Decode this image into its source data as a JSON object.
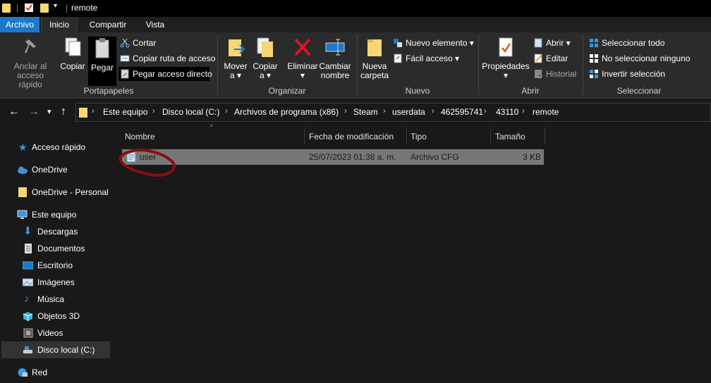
{
  "window": {
    "title": "remote"
  },
  "ribbon_tabs": [
    "Archivo",
    "Inicio",
    "Compartir",
    "Vista"
  ],
  "ribbon": {
    "portapapeles": {
      "label": "Portapapeles",
      "anclar": "Anclar al acceso rápido",
      "copiar": "Copiar",
      "pegar": "Pegar",
      "cortar": "Cortar",
      "copiar_ruta": "Copiar ruta de acceso",
      "pegar_acceso": "Pegar acceso directo"
    },
    "organizar": {
      "label": "Organizar",
      "mover": "Mover a",
      "copiar_a": "Copiar a",
      "eliminar": "Eliminar",
      "cambiar_nombre": "Cambiar nombre"
    },
    "nuevo": {
      "label": "Nuevo",
      "nueva_carpeta": "Nueva carpeta",
      "nuevo_elemento": "Nuevo elemento",
      "facil_acceso": "Fácil acceso"
    },
    "abrir": {
      "label": "Abrir",
      "propiedades": "Propiedades",
      "abrir": "Abrir",
      "editar": "Editar",
      "historial": "Historial"
    },
    "seleccionar": {
      "label": "Seleccionar",
      "todo": "Seleccionar todo",
      "ninguno": "No seleccionar ninguno",
      "invertir": "Invertir selección"
    }
  },
  "address": {
    "crumbs": [
      "Este equipo",
      "Disco local (C:)",
      "Archivos de programa (x86)",
      "Steam",
      "userdata",
      "462595741",
      "43110",
      "remote"
    ]
  },
  "nav": {
    "items": [
      "Acceso rápido",
      "OneDrive",
      "OneDrive - Personal",
      "Este equipo",
      "Descargas",
      "Documentos",
      "Escritorio",
      "Imágenes",
      "Música",
      "Objetos 3D",
      "Videos",
      "Disco local (C:)",
      "Red"
    ]
  },
  "columns": [
    "Nombre",
    "Fecha de modificación",
    "Tipo",
    "Tamaño"
  ],
  "files": [
    {
      "name": "user",
      "modified": "25/07/2023 01:38 a. m.",
      "type": "Archivo CFG",
      "size": "3 KB"
    }
  ],
  "colors": {
    "accent": "#1979ca",
    "folder": "#f7d774",
    "annotation": "#8b0e0e"
  }
}
